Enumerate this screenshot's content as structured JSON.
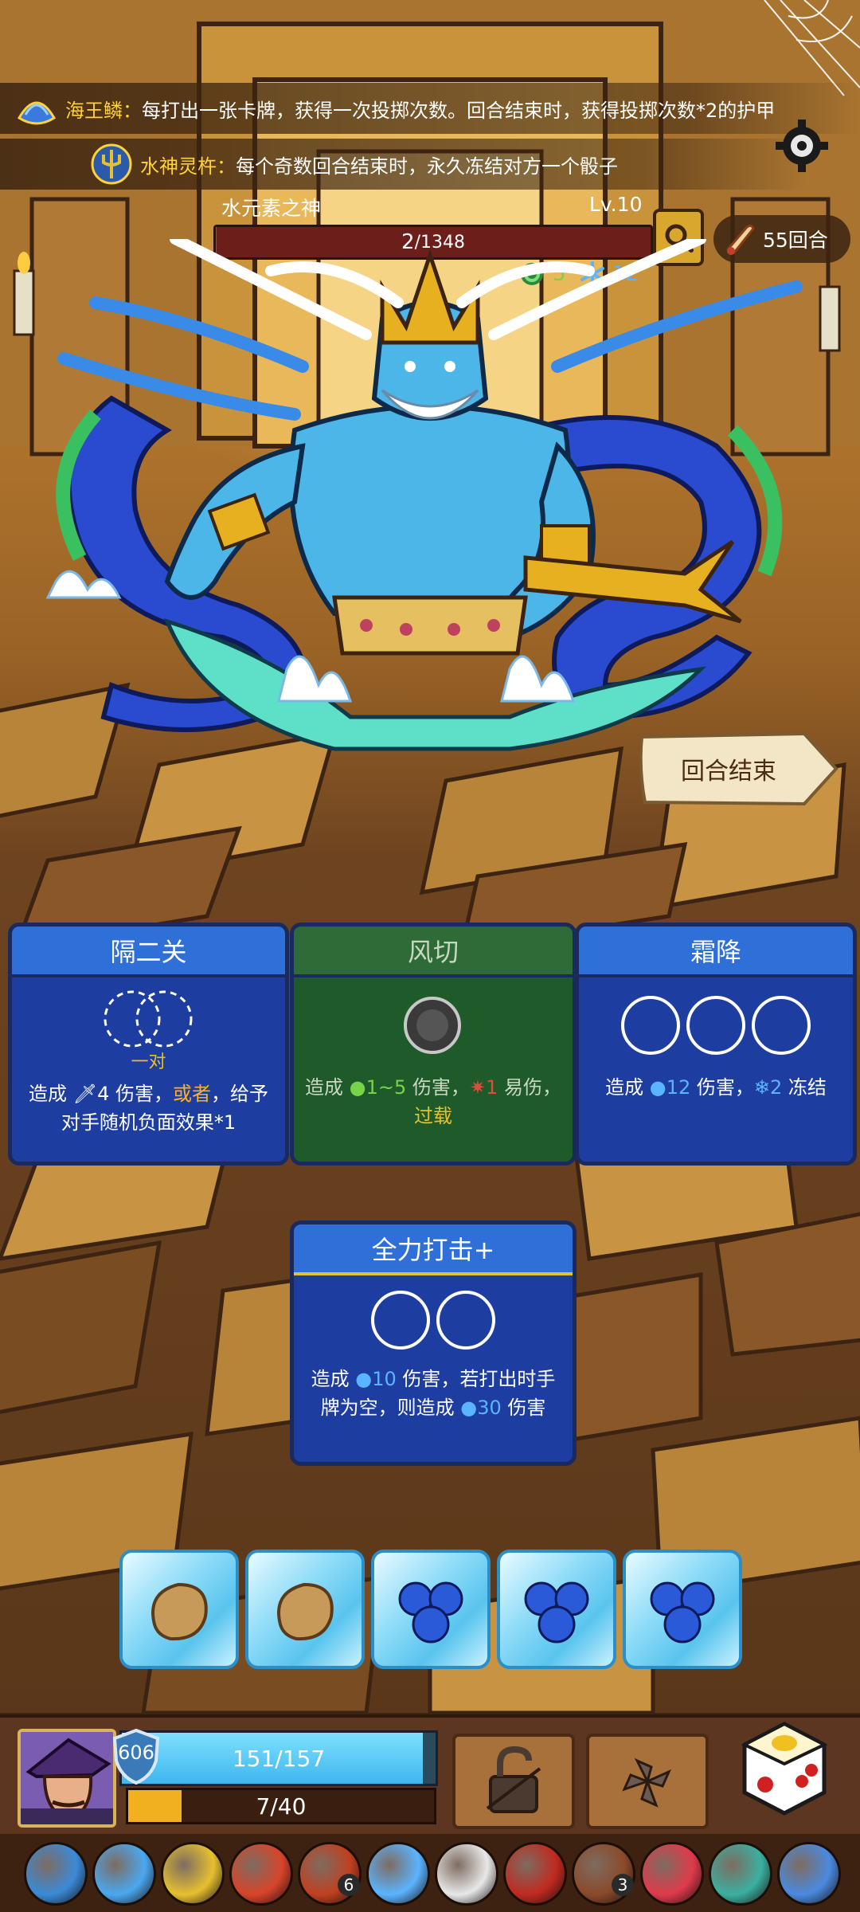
{
  "passives": [
    {
      "name": "海王鳞：",
      "desc": "每打出一张卡牌，获得一次投掷次数。回合结束时，获得投掷次数*2的护甲",
      "icon": "scale-icon",
      "color": "#3a7ae0"
    },
    {
      "name": "水神灵杵：",
      "desc": "每个奇数回合结束时，永久冻结对方一个骰子",
      "icon": "trident-icon",
      "color": "#5ab4ff"
    }
  ],
  "boss": {
    "name": "水元素之神",
    "level": "Lv.10",
    "hp_current": "2",
    "hp_max": "/1348",
    "hp_fraction": 0.0015,
    "status_poison": "5",
    "status_freeze": "12"
  },
  "round": {
    "label": "55回合"
  },
  "end_turn": {
    "label": "回合结束"
  },
  "cards": [
    {
      "title": "隔二关",
      "slot_label": "一对",
      "desc_prefix": "造成 ",
      "desc_value": "4",
      "desc_mid": " 伤害，",
      "desc_or": "或者",
      "desc_suffix": "，给予对手随机负面效果*1"
    },
    {
      "title": "风切",
      "desc_prefix": "造成 ",
      "desc_value": "1~5",
      "desc_mid": " 伤害，",
      "desc_value2": "1",
      "desc_suffix": " 易伤，",
      "desc_tag": "过载"
    },
    {
      "title": "霜降",
      "desc_prefix": "造成 ",
      "desc_value": "12",
      "desc_mid": " 伤害，",
      "desc_value2": "2",
      "desc_suffix": " 冻结"
    },
    {
      "title": "全力打击+",
      "desc_prefix": "造成 ",
      "desc_value": "10",
      "desc_mid": " 伤害，若打出时手牌为空，则造成 ",
      "desc_value2": "30",
      "desc_suffix": " 伤害"
    }
  ],
  "dice": [
    "seed-die",
    "seed-die",
    "water-die",
    "water-die",
    "water-die"
  ],
  "player": {
    "armor": "606",
    "hp": "151/157",
    "hp_fraction": 0.96,
    "xp": "7/40",
    "xp_fraction": 0.175
  },
  "relics": [
    {
      "icon": "water-gear-relic-icon",
      "color": "#3a8ad8"
    },
    {
      "icon": "water-drop-relic-icon",
      "color": "#4aa8f0"
    },
    {
      "icon": "crown-relic-icon",
      "color": "#e6c030"
    },
    {
      "icon": "red-horn-relic-icon",
      "color": "#d8442a"
    },
    {
      "icon": "shield-relic-icon",
      "color": "#c04020",
      "count": "6"
    },
    {
      "icon": "crystal-relic-icon",
      "color": "#5ab4ff"
    },
    {
      "icon": "skull-relic-icon",
      "color": "#e8e8e8"
    },
    {
      "icon": "red-hood-relic-icon",
      "color": "#c02a20"
    },
    {
      "icon": "bean-relic-icon",
      "color": "#8a4a2a",
      "count": "3"
    },
    {
      "icon": "seven-relic-icon",
      "color": "#e03a4a"
    },
    {
      "icon": "dragon-relic-icon",
      "color": "#3ab0a0"
    },
    {
      "icon": "fish-relic-icon",
      "color": "#4a8ae0"
    }
  ]
}
